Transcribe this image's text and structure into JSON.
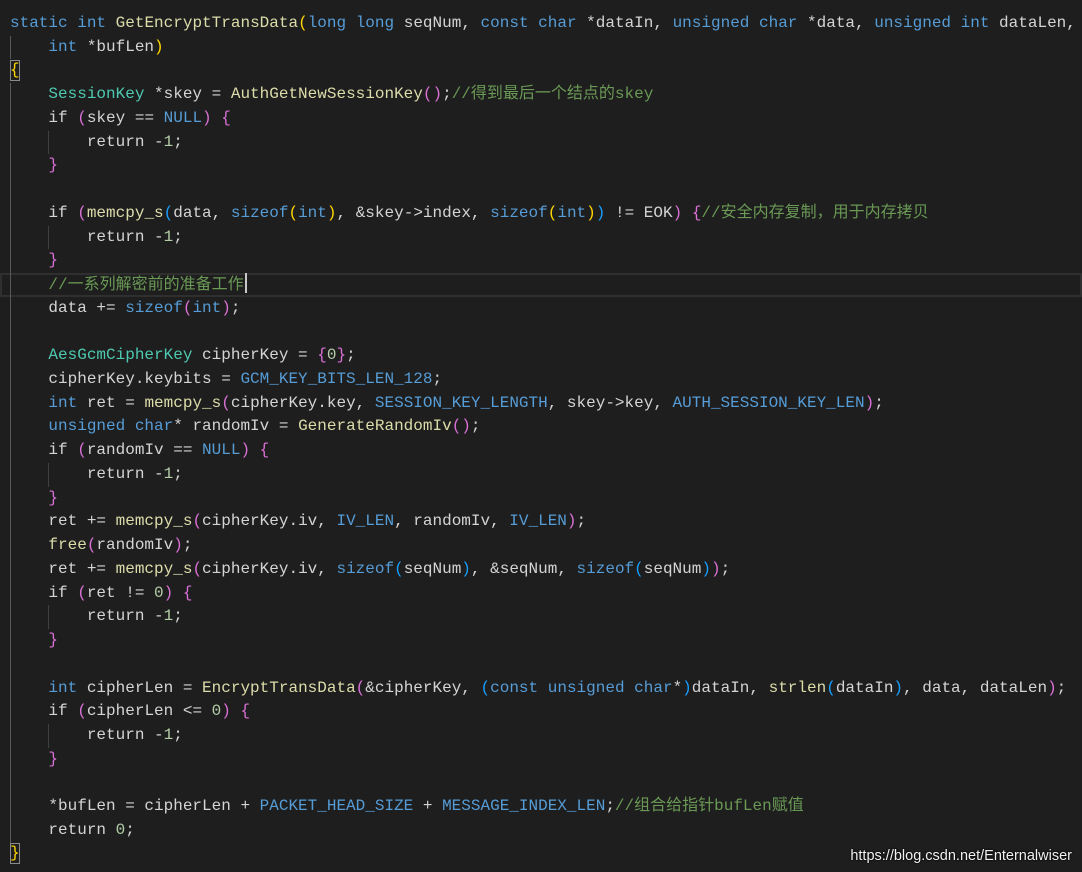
{
  "editor": {
    "background": "#1e1e1e",
    "cursor_line": 12,
    "lines": [
      [
        [
          "static",
          "#569cd6"
        ],
        [
          " ",
          "#d4d4d4"
        ],
        [
          "int",
          "#569cd6"
        ],
        [
          " ",
          "#d4d4d4"
        ],
        [
          "GetEncryptTransData",
          "#dcdcaa"
        ],
        [
          "(",
          "#ffd700"
        ],
        [
          "long",
          "#569cd6"
        ],
        [
          " ",
          "#d4d4d4"
        ],
        [
          "long",
          "#569cd6"
        ],
        [
          " seqNum, ",
          "#d4d4d4"
        ],
        [
          "const",
          "#569cd6"
        ],
        [
          " ",
          "#d4d4d4"
        ],
        [
          "char",
          "#569cd6"
        ],
        [
          " *dataIn, ",
          "#d4d4d4"
        ],
        [
          "unsigned",
          "#569cd6"
        ],
        [
          " ",
          "#d4d4d4"
        ],
        [
          "char",
          "#569cd6"
        ],
        [
          " *data, ",
          "#d4d4d4"
        ],
        [
          "unsigned",
          "#569cd6"
        ],
        [
          " ",
          "#d4d4d4"
        ],
        [
          "int",
          "#569cd6"
        ],
        [
          " dataLen,",
          "#d4d4d4"
        ]
      ],
      [
        [
          "    ",
          "#d4d4d4"
        ],
        [
          "int",
          "#569cd6"
        ],
        [
          " *bufLen",
          "#d4d4d4"
        ],
        [
          ")",
          "#ffd700"
        ]
      ],
      [
        [
          "{",
          "#ffd700",
          true
        ]
      ],
      [
        [
          "    ",
          "#d4d4d4"
        ],
        [
          "SessionKey",
          "#4ec9b0"
        ],
        [
          " *skey = ",
          "#d4d4d4"
        ],
        [
          "AuthGetNewSessionKey",
          "#dcdcaa"
        ],
        [
          "(",
          "#da70d6"
        ],
        [
          ")",
          "#da70d6"
        ],
        [
          ";",
          "#d4d4d4"
        ],
        [
          "//得到最后一个结点的skey",
          "#6a9955"
        ]
      ],
      [
        [
          "    if ",
          "#d4d4d4"
        ],
        [
          "(",
          "#da70d6"
        ],
        [
          "skey == ",
          "#d4d4d4"
        ],
        [
          "NULL",
          "#569cd6"
        ],
        [
          ")",
          "#da70d6"
        ],
        [
          " ",
          "#d4d4d4"
        ],
        [
          "{",
          "#da70d6"
        ]
      ],
      [
        [
          "        return -",
          "#d4d4d4"
        ],
        [
          "1",
          "#b5cea8"
        ],
        [
          ";",
          "#d4d4d4"
        ]
      ],
      [
        [
          "    ",
          "#d4d4d4"
        ],
        [
          "}",
          "#da70d6"
        ]
      ],
      [],
      [
        [
          "    if ",
          "#d4d4d4"
        ],
        [
          "(",
          "#da70d6"
        ],
        [
          "memcpy_s",
          "#dcdcaa"
        ],
        [
          "(",
          "#179fff"
        ],
        [
          "data, ",
          "#d4d4d4"
        ],
        [
          "sizeof",
          "#569cd6"
        ],
        [
          "(",
          "#ffd700"
        ],
        [
          "int",
          "#569cd6"
        ],
        [
          ")",
          "#ffd700"
        ],
        [
          ", &skey->index, ",
          "#d4d4d4"
        ],
        [
          "sizeof",
          "#569cd6"
        ],
        [
          "(",
          "#ffd700"
        ],
        [
          "int",
          "#569cd6"
        ],
        [
          ")",
          "#ffd700"
        ],
        [
          ")",
          "#179fff"
        ],
        [
          " != EOK",
          "#d4d4d4"
        ],
        [
          ")",
          "#da70d6"
        ],
        [
          " ",
          "#d4d4d4"
        ],
        [
          "{",
          "#da70d6"
        ],
        [
          "//安全内存复制，用于内存拷贝",
          "#6a9955"
        ]
      ],
      [
        [
          "        return -",
          "#d4d4d4"
        ],
        [
          "1",
          "#b5cea8"
        ],
        [
          ";",
          "#d4d4d4"
        ]
      ],
      [
        [
          "    ",
          "#d4d4d4"
        ],
        [
          "}",
          "#da70d6"
        ]
      ],
      [
        [
          "    ",
          "#d4d4d4"
        ],
        [
          "//一系列解密前的准备工作",
          "#6a9955"
        ]
      ],
      [
        [
          "    data += ",
          "#d4d4d4"
        ],
        [
          "sizeof",
          "#569cd6"
        ],
        [
          "(",
          "#da70d6"
        ],
        [
          "int",
          "#569cd6"
        ],
        [
          ")",
          "#da70d6"
        ],
        [
          ";",
          "#d4d4d4"
        ]
      ],
      [],
      [
        [
          "    ",
          "#d4d4d4"
        ],
        [
          "AesGcmCipherKey",
          "#4ec9b0"
        ],
        [
          " cipherKey = ",
          "#d4d4d4"
        ],
        [
          "{",
          "#da70d6"
        ],
        [
          "0",
          "#b5cea8"
        ],
        [
          "}",
          "#da70d6"
        ],
        [
          ";",
          "#d4d4d4"
        ]
      ],
      [
        [
          "    cipherKey.keybits = ",
          "#d4d4d4"
        ],
        [
          "GCM_KEY_BITS_LEN_128",
          "#569cd6"
        ],
        [
          ";",
          "#d4d4d4"
        ]
      ],
      [
        [
          "    ",
          "#d4d4d4"
        ],
        [
          "int",
          "#569cd6"
        ],
        [
          " ret = ",
          "#d4d4d4"
        ],
        [
          "memcpy_s",
          "#dcdcaa"
        ],
        [
          "(",
          "#da70d6"
        ],
        [
          "cipherKey.key, ",
          "#d4d4d4"
        ],
        [
          "SESSION_KEY_LENGTH",
          "#569cd6"
        ],
        [
          ", skey->key, ",
          "#d4d4d4"
        ],
        [
          "AUTH_SESSION_KEY_LEN",
          "#569cd6"
        ],
        [
          ")",
          "#da70d6"
        ],
        [
          ";",
          "#d4d4d4"
        ]
      ],
      [
        [
          "    ",
          "#d4d4d4"
        ],
        [
          "unsigned",
          "#569cd6"
        ],
        [
          " ",
          "#d4d4d4"
        ],
        [
          "char",
          "#569cd6"
        ],
        [
          "* randomIv = ",
          "#d4d4d4"
        ],
        [
          "GenerateRandomIv",
          "#dcdcaa"
        ],
        [
          "(",
          "#da70d6"
        ],
        [
          ")",
          "#da70d6"
        ],
        [
          ";",
          "#d4d4d4"
        ]
      ],
      [
        [
          "    if ",
          "#d4d4d4"
        ],
        [
          "(",
          "#da70d6"
        ],
        [
          "randomIv == ",
          "#d4d4d4"
        ],
        [
          "NULL",
          "#569cd6"
        ],
        [
          ")",
          "#da70d6"
        ],
        [
          " ",
          "#d4d4d4"
        ],
        [
          "{",
          "#da70d6"
        ]
      ],
      [
        [
          "        return -",
          "#d4d4d4"
        ],
        [
          "1",
          "#b5cea8"
        ],
        [
          ";",
          "#d4d4d4"
        ]
      ],
      [
        [
          "    ",
          "#d4d4d4"
        ],
        [
          "}",
          "#da70d6"
        ]
      ],
      [
        [
          "    ret += ",
          "#d4d4d4"
        ],
        [
          "memcpy_s",
          "#dcdcaa"
        ],
        [
          "(",
          "#da70d6"
        ],
        [
          "cipherKey.iv, ",
          "#d4d4d4"
        ],
        [
          "IV_LEN",
          "#569cd6"
        ],
        [
          ", randomIv, ",
          "#d4d4d4"
        ],
        [
          "IV_LEN",
          "#569cd6"
        ],
        [
          ")",
          "#da70d6"
        ],
        [
          ";",
          "#d4d4d4"
        ]
      ],
      [
        [
          "    ",
          "#d4d4d4"
        ],
        [
          "free",
          "#dcdcaa"
        ],
        [
          "(",
          "#da70d6"
        ],
        [
          "randomIv",
          "#d4d4d4"
        ],
        [
          ")",
          "#da70d6"
        ],
        [
          ";",
          "#d4d4d4"
        ]
      ],
      [
        [
          "    ret += ",
          "#d4d4d4"
        ],
        [
          "memcpy_s",
          "#dcdcaa"
        ],
        [
          "(",
          "#da70d6"
        ],
        [
          "cipherKey.iv, ",
          "#d4d4d4"
        ],
        [
          "sizeof",
          "#569cd6"
        ],
        [
          "(",
          "#179fff"
        ],
        [
          "seqNum",
          "#d4d4d4"
        ],
        [
          ")",
          "#179fff"
        ],
        [
          ", &seqNum, ",
          "#d4d4d4"
        ],
        [
          "sizeof",
          "#569cd6"
        ],
        [
          "(",
          "#179fff"
        ],
        [
          "seqNum",
          "#d4d4d4"
        ],
        [
          ")",
          "#179fff"
        ],
        [
          ")",
          "#da70d6"
        ],
        [
          ";",
          "#d4d4d4"
        ]
      ],
      [
        [
          "    if ",
          "#d4d4d4"
        ],
        [
          "(",
          "#da70d6"
        ],
        [
          "ret != ",
          "#d4d4d4"
        ],
        [
          "0",
          "#b5cea8"
        ],
        [
          ")",
          "#da70d6"
        ],
        [
          " ",
          "#d4d4d4"
        ],
        [
          "{",
          "#da70d6"
        ]
      ],
      [
        [
          "        return -",
          "#d4d4d4"
        ],
        [
          "1",
          "#b5cea8"
        ],
        [
          ";",
          "#d4d4d4"
        ]
      ],
      [
        [
          "    ",
          "#d4d4d4"
        ],
        [
          "}",
          "#da70d6"
        ]
      ],
      [],
      [
        [
          "    ",
          "#d4d4d4"
        ],
        [
          "int",
          "#569cd6"
        ],
        [
          " cipherLen = ",
          "#d4d4d4"
        ],
        [
          "EncryptTransData",
          "#dcdcaa"
        ],
        [
          "(",
          "#da70d6"
        ],
        [
          "&cipherKey, ",
          "#d4d4d4"
        ],
        [
          "(",
          "#179fff"
        ],
        [
          "const",
          "#569cd6"
        ],
        [
          " ",
          "#d4d4d4"
        ],
        [
          "unsigned",
          "#569cd6"
        ],
        [
          " ",
          "#d4d4d4"
        ],
        [
          "char",
          "#569cd6"
        ],
        [
          "*",
          "#d4d4d4"
        ],
        [
          ")",
          "#179fff"
        ],
        [
          "dataIn, ",
          "#d4d4d4"
        ],
        [
          "strlen",
          "#dcdcaa"
        ],
        [
          "(",
          "#179fff"
        ],
        [
          "dataIn",
          "#d4d4d4"
        ],
        [
          ")",
          "#179fff"
        ],
        [
          ", data, dataLen",
          "#d4d4d4"
        ],
        [
          ")",
          "#da70d6"
        ],
        [
          ";",
          "#d4d4d4"
        ]
      ],
      [
        [
          "    if ",
          "#d4d4d4"
        ],
        [
          "(",
          "#da70d6"
        ],
        [
          "cipherLen <= ",
          "#d4d4d4"
        ],
        [
          "0",
          "#b5cea8"
        ],
        [
          ")",
          "#da70d6"
        ],
        [
          " ",
          "#d4d4d4"
        ],
        [
          "{",
          "#da70d6"
        ]
      ],
      [
        [
          "        return -",
          "#d4d4d4"
        ],
        [
          "1",
          "#b5cea8"
        ],
        [
          ";",
          "#d4d4d4"
        ]
      ],
      [
        [
          "    ",
          "#d4d4d4"
        ],
        [
          "}",
          "#da70d6"
        ]
      ],
      [],
      [
        [
          "    *bufLen = cipherLen + ",
          "#d4d4d4"
        ],
        [
          "PACKET_HEAD_SIZE",
          "#569cd6"
        ],
        [
          " + ",
          "#d4d4d4"
        ],
        [
          "MESSAGE_INDEX_LEN",
          "#569cd6"
        ],
        [
          ";",
          "#d4d4d4"
        ],
        [
          "//组合给指针bufLen赋值",
          "#6a9955"
        ]
      ],
      [
        [
          "    return ",
          "#d4d4d4"
        ],
        [
          "0",
          "#b5cea8"
        ],
        [
          ";",
          "#d4d4d4"
        ]
      ],
      [
        [
          "}",
          "#ffd700",
          true
        ]
      ]
    ]
  },
  "watermark": "https://blog.csdn.net/Enternalwiser"
}
